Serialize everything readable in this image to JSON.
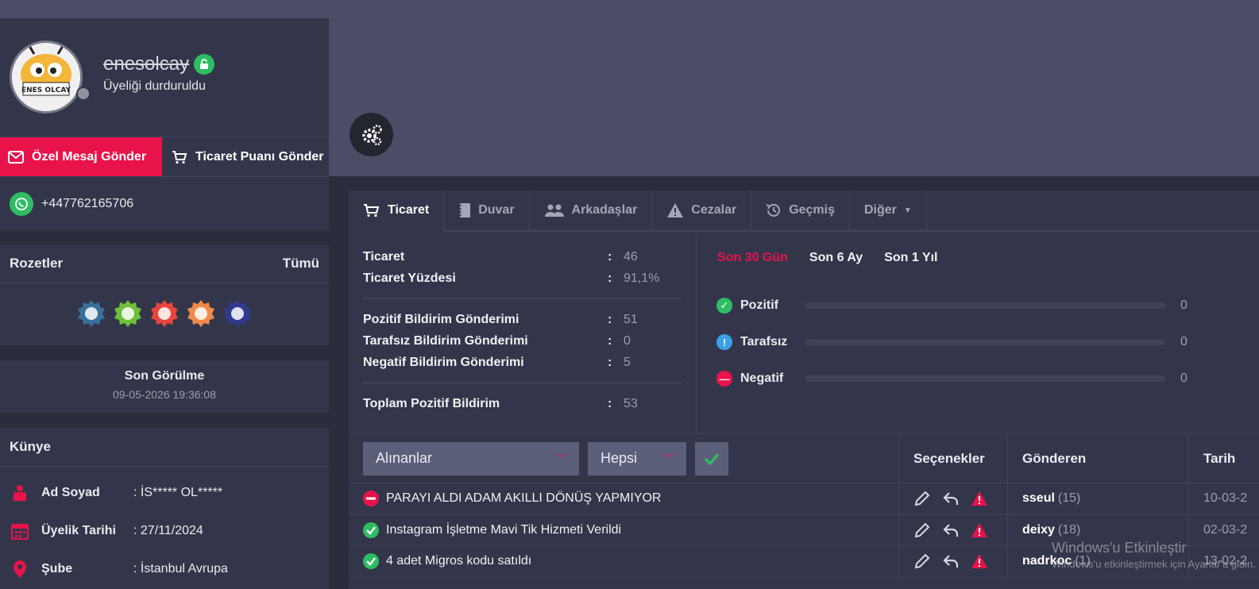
{
  "profile": {
    "username": "enesolcay",
    "avatar_text": "ENES OLCAY",
    "status": "Üyeliği durduruldu",
    "send_message_label": "Özel Mesaj Gönder",
    "send_trade_point_label": "Ticaret Puanı Gönder",
    "phone": "+447762165706"
  },
  "badges": {
    "title": "Rozetler",
    "all_label": "Tümü",
    "items": [
      {
        "name": "chat",
        "color": "#3a6f9a"
      },
      {
        "name": "folder",
        "color": "#6fbf3a"
      },
      {
        "name": "handshake",
        "color": "#e8453c"
      },
      {
        "name": "thumbs-up",
        "color": "#f08a4b"
      },
      {
        "name": "smiley",
        "color": "#2f3a8f"
      }
    ]
  },
  "last_seen": {
    "title": "Son Görülme",
    "date": "09-05-2026 19:36:08"
  },
  "kunye": {
    "title": "Künye",
    "rows": [
      {
        "label": "Ad Soyad",
        "value": ": İS***** OL*****"
      },
      {
        "label": "Üyelik Tarihi",
        "value": ": 27/11/2024"
      },
      {
        "label": "Şube",
        "value": ": İstanbul Avrupa"
      }
    ]
  },
  "tabs": [
    {
      "label": "Ticaret",
      "icon": "cart-icon",
      "active": true
    },
    {
      "label": "Duvar",
      "icon": "notebook-icon"
    },
    {
      "label": "Arkadaşlar",
      "icon": "users-icon"
    },
    {
      "label": "Cezalar",
      "icon": "warning-icon"
    },
    {
      "label": "Geçmiş",
      "icon": "history-icon"
    },
    {
      "label": "Diğer",
      "icon": "caret-down-icon"
    }
  ],
  "stats": {
    "group1": [
      {
        "label": "Ticaret",
        "value": "46"
      },
      {
        "label": "Ticaret Yüzdesi",
        "value": "91,1%"
      }
    ],
    "group2": [
      {
        "label": "Pozitif Bildirim Gönderimi",
        "value": "51"
      },
      {
        "label": "Tarafsız Bildirim Gönderimi",
        "value": "0"
      },
      {
        "label": "Negatif Bildirim Gönderimi",
        "value": "5"
      }
    ],
    "group3": [
      {
        "label": "Toplam Pozitif Bildirim",
        "value": "53"
      }
    ]
  },
  "periods": [
    "Son 30 Gün",
    "Son 6 Ay",
    "Son 1 Yıl"
  ],
  "ratings": [
    {
      "label": "Pozitif",
      "count": "0",
      "color": "#2ebd62",
      "glyph": "✓"
    },
    {
      "label": "Tarafsız",
      "count": "0",
      "color": "#3aa0e8",
      "glyph": "!"
    },
    {
      "label": "Negatif",
      "count": "0",
      "color": "#e8134a",
      "glyph": "—"
    }
  ],
  "table": {
    "filter_type": "Alınanlar",
    "filter_scope": "Hepsi",
    "col_options": "Seçenekler",
    "col_sender": "Gönderen",
    "col_date": "Tarih",
    "rows": [
      {
        "type": "negative",
        "title": "PARAYI ALDI ADAM AKILLI DÖNÜŞ YAPMIYOR",
        "sender": "sseul",
        "count": "(15)",
        "date": "10-03-2"
      },
      {
        "type": "positive",
        "title": "Instagram İşletme Mavi Tik Hizmeti Verildi",
        "sender": "deixy",
        "count": "(18)",
        "date": "02-03-2"
      },
      {
        "type": "positive",
        "title": "4 adet Migros kodu satıldı",
        "sender": "nadrkoc",
        "count": "(1)",
        "date": "13-02-2"
      }
    ]
  },
  "watermark": {
    "line1": "Windows'u Etkinleştir",
    "line2": "Windows'u etkinleştirmek için Ayarlar'a gidin."
  }
}
